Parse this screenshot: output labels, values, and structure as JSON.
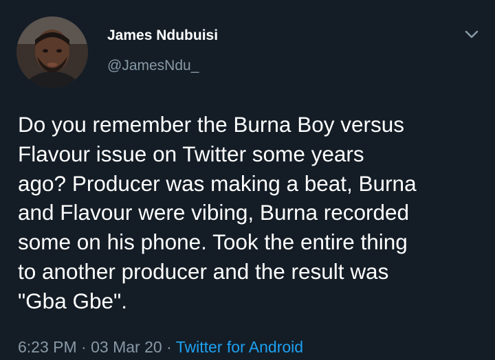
{
  "user": {
    "display_name": "James Ndubuisi",
    "handle": "@JamesNdu_",
    "avatar_icon": "profile-photo"
  },
  "tweet": {
    "lines": [
      "Do you remember the Burna Boy versus",
      "Flavour issue on Twitter some years",
      "ago? Producer was making a beat, Burna",
      "and Flavour were vibing, Burna recorded",
      "some on his phone. Took the entire thing",
      "to another producer and the result was",
      "\"Gba Gbe\"."
    ],
    "time": "6:23 PM",
    "separator": "·",
    "date": "03 Mar 20",
    "source": "Twitter for Android"
  },
  "menu": {
    "icon": "chevron-down-icon"
  },
  "colors": {
    "background": "#141d26",
    "secondary_text": "#8899a6",
    "link": "#1da1f2"
  }
}
